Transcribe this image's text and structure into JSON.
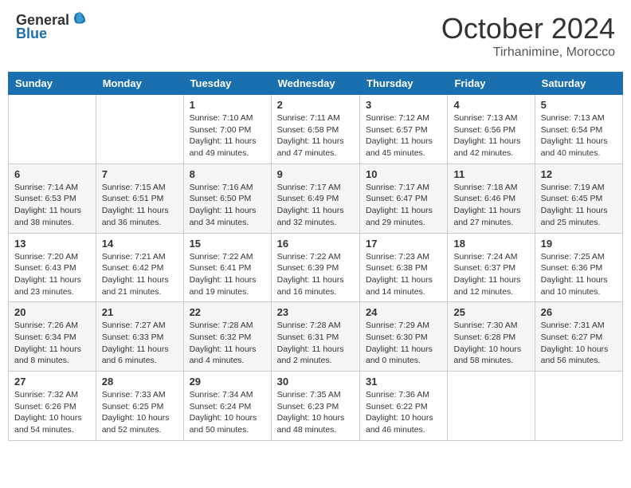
{
  "header": {
    "logo_general": "General",
    "logo_blue": "Blue",
    "month_title": "October 2024",
    "location": "Tirhanimine, Morocco"
  },
  "calendar": {
    "days_of_week": [
      "Sunday",
      "Monday",
      "Tuesday",
      "Wednesday",
      "Thursday",
      "Friday",
      "Saturday"
    ],
    "weeks": [
      [
        {
          "day": "",
          "sunrise": "",
          "sunset": "",
          "daylight": ""
        },
        {
          "day": "",
          "sunrise": "",
          "sunset": "",
          "daylight": ""
        },
        {
          "day": "1",
          "sunrise": "Sunrise: 7:10 AM",
          "sunset": "Sunset: 7:00 PM",
          "daylight": "Daylight: 11 hours and 49 minutes."
        },
        {
          "day": "2",
          "sunrise": "Sunrise: 7:11 AM",
          "sunset": "Sunset: 6:58 PM",
          "daylight": "Daylight: 11 hours and 47 minutes."
        },
        {
          "day": "3",
          "sunrise": "Sunrise: 7:12 AM",
          "sunset": "Sunset: 6:57 PM",
          "daylight": "Daylight: 11 hours and 45 minutes."
        },
        {
          "day": "4",
          "sunrise": "Sunrise: 7:13 AM",
          "sunset": "Sunset: 6:56 PM",
          "daylight": "Daylight: 11 hours and 42 minutes."
        },
        {
          "day": "5",
          "sunrise": "Sunrise: 7:13 AM",
          "sunset": "Sunset: 6:54 PM",
          "daylight": "Daylight: 11 hours and 40 minutes."
        }
      ],
      [
        {
          "day": "6",
          "sunrise": "Sunrise: 7:14 AM",
          "sunset": "Sunset: 6:53 PM",
          "daylight": "Daylight: 11 hours and 38 minutes."
        },
        {
          "day": "7",
          "sunrise": "Sunrise: 7:15 AM",
          "sunset": "Sunset: 6:51 PM",
          "daylight": "Daylight: 11 hours and 36 minutes."
        },
        {
          "day": "8",
          "sunrise": "Sunrise: 7:16 AM",
          "sunset": "Sunset: 6:50 PM",
          "daylight": "Daylight: 11 hours and 34 minutes."
        },
        {
          "day": "9",
          "sunrise": "Sunrise: 7:17 AM",
          "sunset": "Sunset: 6:49 PM",
          "daylight": "Daylight: 11 hours and 32 minutes."
        },
        {
          "day": "10",
          "sunrise": "Sunrise: 7:17 AM",
          "sunset": "Sunset: 6:47 PM",
          "daylight": "Daylight: 11 hours and 29 minutes."
        },
        {
          "day": "11",
          "sunrise": "Sunrise: 7:18 AM",
          "sunset": "Sunset: 6:46 PM",
          "daylight": "Daylight: 11 hours and 27 minutes."
        },
        {
          "day": "12",
          "sunrise": "Sunrise: 7:19 AM",
          "sunset": "Sunset: 6:45 PM",
          "daylight": "Daylight: 11 hours and 25 minutes."
        }
      ],
      [
        {
          "day": "13",
          "sunrise": "Sunrise: 7:20 AM",
          "sunset": "Sunset: 6:43 PM",
          "daylight": "Daylight: 11 hours and 23 minutes."
        },
        {
          "day": "14",
          "sunrise": "Sunrise: 7:21 AM",
          "sunset": "Sunset: 6:42 PM",
          "daylight": "Daylight: 11 hours and 21 minutes."
        },
        {
          "day": "15",
          "sunrise": "Sunrise: 7:22 AM",
          "sunset": "Sunset: 6:41 PM",
          "daylight": "Daylight: 11 hours and 19 minutes."
        },
        {
          "day": "16",
          "sunrise": "Sunrise: 7:22 AM",
          "sunset": "Sunset: 6:39 PM",
          "daylight": "Daylight: 11 hours and 16 minutes."
        },
        {
          "day": "17",
          "sunrise": "Sunrise: 7:23 AM",
          "sunset": "Sunset: 6:38 PM",
          "daylight": "Daylight: 11 hours and 14 minutes."
        },
        {
          "day": "18",
          "sunrise": "Sunrise: 7:24 AM",
          "sunset": "Sunset: 6:37 PM",
          "daylight": "Daylight: 11 hours and 12 minutes."
        },
        {
          "day": "19",
          "sunrise": "Sunrise: 7:25 AM",
          "sunset": "Sunset: 6:36 PM",
          "daylight": "Daylight: 11 hours and 10 minutes."
        }
      ],
      [
        {
          "day": "20",
          "sunrise": "Sunrise: 7:26 AM",
          "sunset": "Sunset: 6:34 PM",
          "daylight": "Daylight: 11 hours and 8 minutes."
        },
        {
          "day": "21",
          "sunrise": "Sunrise: 7:27 AM",
          "sunset": "Sunset: 6:33 PM",
          "daylight": "Daylight: 11 hours and 6 minutes."
        },
        {
          "day": "22",
          "sunrise": "Sunrise: 7:28 AM",
          "sunset": "Sunset: 6:32 PM",
          "daylight": "Daylight: 11 hours and 4 minutes."
        },
        {
          "day": "23",
          "sunrise": "Sunrise: 7:28 AM",
          "sunset": "Sunset: 6:31 PM",
          "daylight": "Daylight: 11 hours and 2 minutes."
        },
        {
          "day": "24",
          "sunrise": "Sunrise: 7:29 AM",
          "sunset": "Sunset: 6:30 PM",
          "daylight": "Daylight: 11 hours and 0 minutes."
        },
        {
          "day": "25",
          "sunrise": "Sunrise: 7:30 AM",
          "sunset": "Sunset: 6:28 PM",
          "daylight": "Daylight: 10 hours and 58 minutes."
        },
        {
          "day": "26",
          "sunrise": "Sunrise: 7:31 AM",
          "sunset": "Sunset: 6:27 PM",
          "daylight": "Daylight: 10 hours and 56 minutes."
        }
      ],
      [
        {
          "day": "27",
          "sunrise": "Sunrise: 7:32 AM",
          "sunset": "Sunset: 6:26 PM",
          "daylight": "Daylight: 10 hours and 54 minutes."
        },
        {
          "day": "28",
          "sunrise": "Sunrise: 7:33 AM",
          "sunset": "Sunset: 6:25 PM",
          "daylight": "Daylight: 10 hours and 52 minutes."
        },
        {
          "day": "29",
          "sunrise": "Sunrise: 7:34 AM",
          "sunset": "Sunset: 6:24 PM",
          "daylight": "Daylight: 10 hours and 50 minutes."
        },
        {
          "day": "30",
          "sunrise": "Sunrise: 7:35 AM",
          "sunset": "Sunset: 6:23 PM",
          "daylight": "Daylight: 10 hours and 48 minutes."
        },
        {
          "day": "31",
          "sunrise": "Sunrise: 7:36 AM",
          "sunset": "Sunset: 6:22 PM",
          "daylight": "Daylight: 10 hours and 46 minutes."
        },
        {
          "day": "",
          "sunrise": "",
          "sunset": "",
          "daylight": ""
        },
        {
          "day": "",
          "sunrise": "",
          "sunset": "",
          "daylight": ""
        }
      ]
    ]
  }
}
